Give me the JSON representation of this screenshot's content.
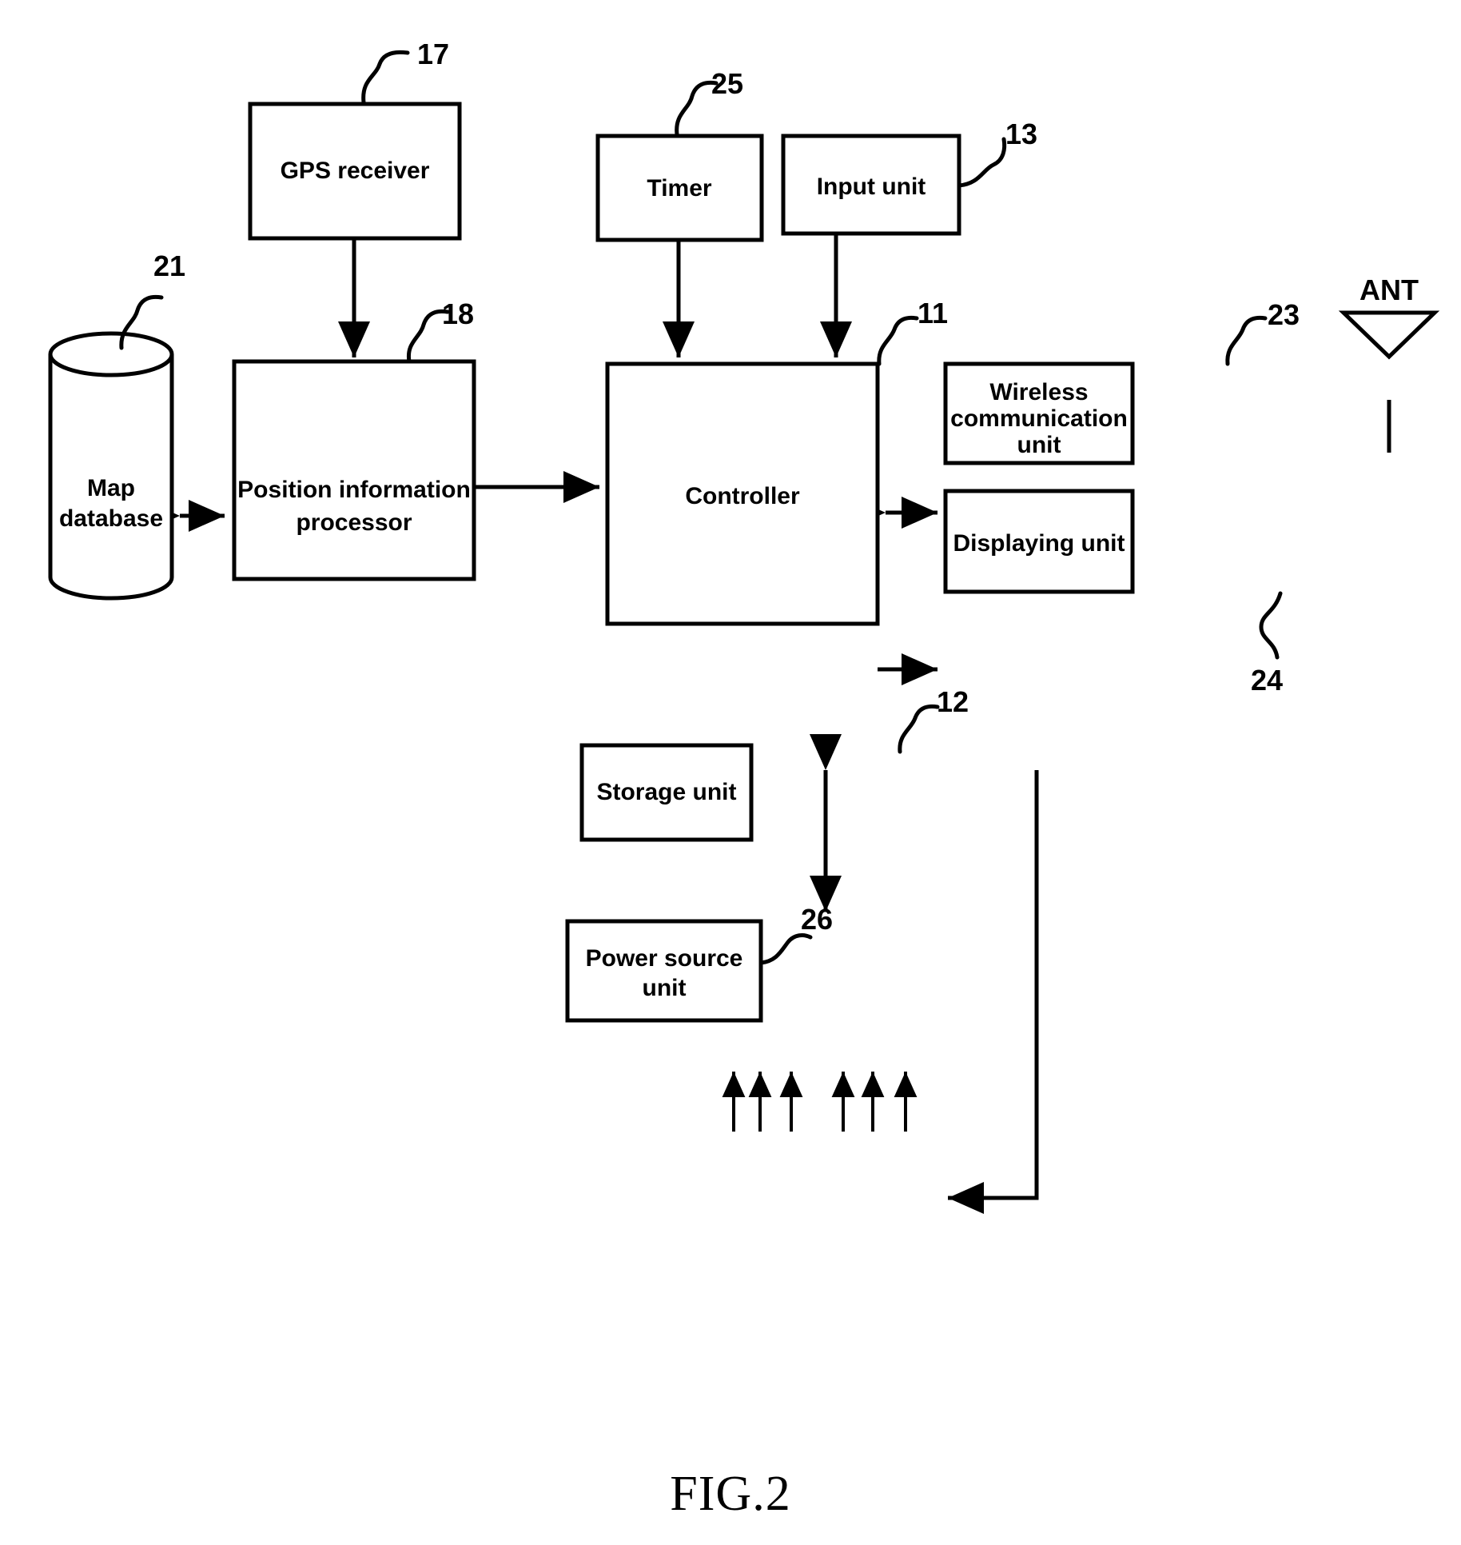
{
  "figure": {
    "caption": "FIG.2",
    "antenna_label": "ANT"
  },
  "blocks": [
    {
      "id": "gps-receiver",
      "label": "GPS receiver",
      "ref": "17"
    },
    {
      "id": "map-database",
      "label_line1": "Map",
      "label_line2": "database",
      "ref": "21"
    },
    {
      "id": "position-info-processor",
      "label_line1": "Position information",
      "label_line2": "processor",
      "ref": "18"
    },
    {
      "id": "timer",
      "label": "Timer",
      "ref": "25"
    },
    {
      "id": "input-unit",
      "label": "Input unit",
      "ref": "13"
    },
    {
      "id": "controller",
      "label": "Controller",
      "ref": "11"
    },
    {
      "id": "wireless-communication-unit",
      "label_line1": "Wireless",
      "label_line2": "communication",
      "label_line3": "unit",
      "ref": "23"
    },
    {
      "id": "displaying-unit",
      "label": "Displaying unit",
      "ref": "24"
    },
    {
      "id": "storage-unit",
      "label": "Storage unit",
      "ref": "12"
    },
    {
      "id": "power-source-unit",
      "label_line1": "Power source",
      "label_line2": "unit",
      "ref": "26"
    }
  ],
  "text": {
    "gps_receiver": "GPS receiver",
    "map_db_l1": "Map",
    "map_db_l2": "database",
    "pos_proc_l1": "Position information",
    "pos_proc_l2": "processor",
    "timer": "Timer",
    "input_unit": "Input unit",
    "controller": "Controller",
    "wireless_l1": "Wireless",
    "wireless_l2": "communication",
    "wireless_l3": "unit",
    "displaying_unit": "Displaying unit",
    "storage_unit": "Storage unit",
    "power_l1": "Power source",
    "power_l2": "unit",
    "ant": "ANT",
    "caption": "FIG.2"
  },
  "refs": {
    "gps_receiver": "17",
    "map_database": "21",
    "position_processor": "18",
    "timer": "25",
    "input_unit": "13",
    "controller": "11",
    "wireless": "23",
    "displaying": "24",
    "storage": "12",
    "power": "26"
  },
  "colors": {
    "stroke": "#000000",
    "background": "#ffffff"
  }
}
